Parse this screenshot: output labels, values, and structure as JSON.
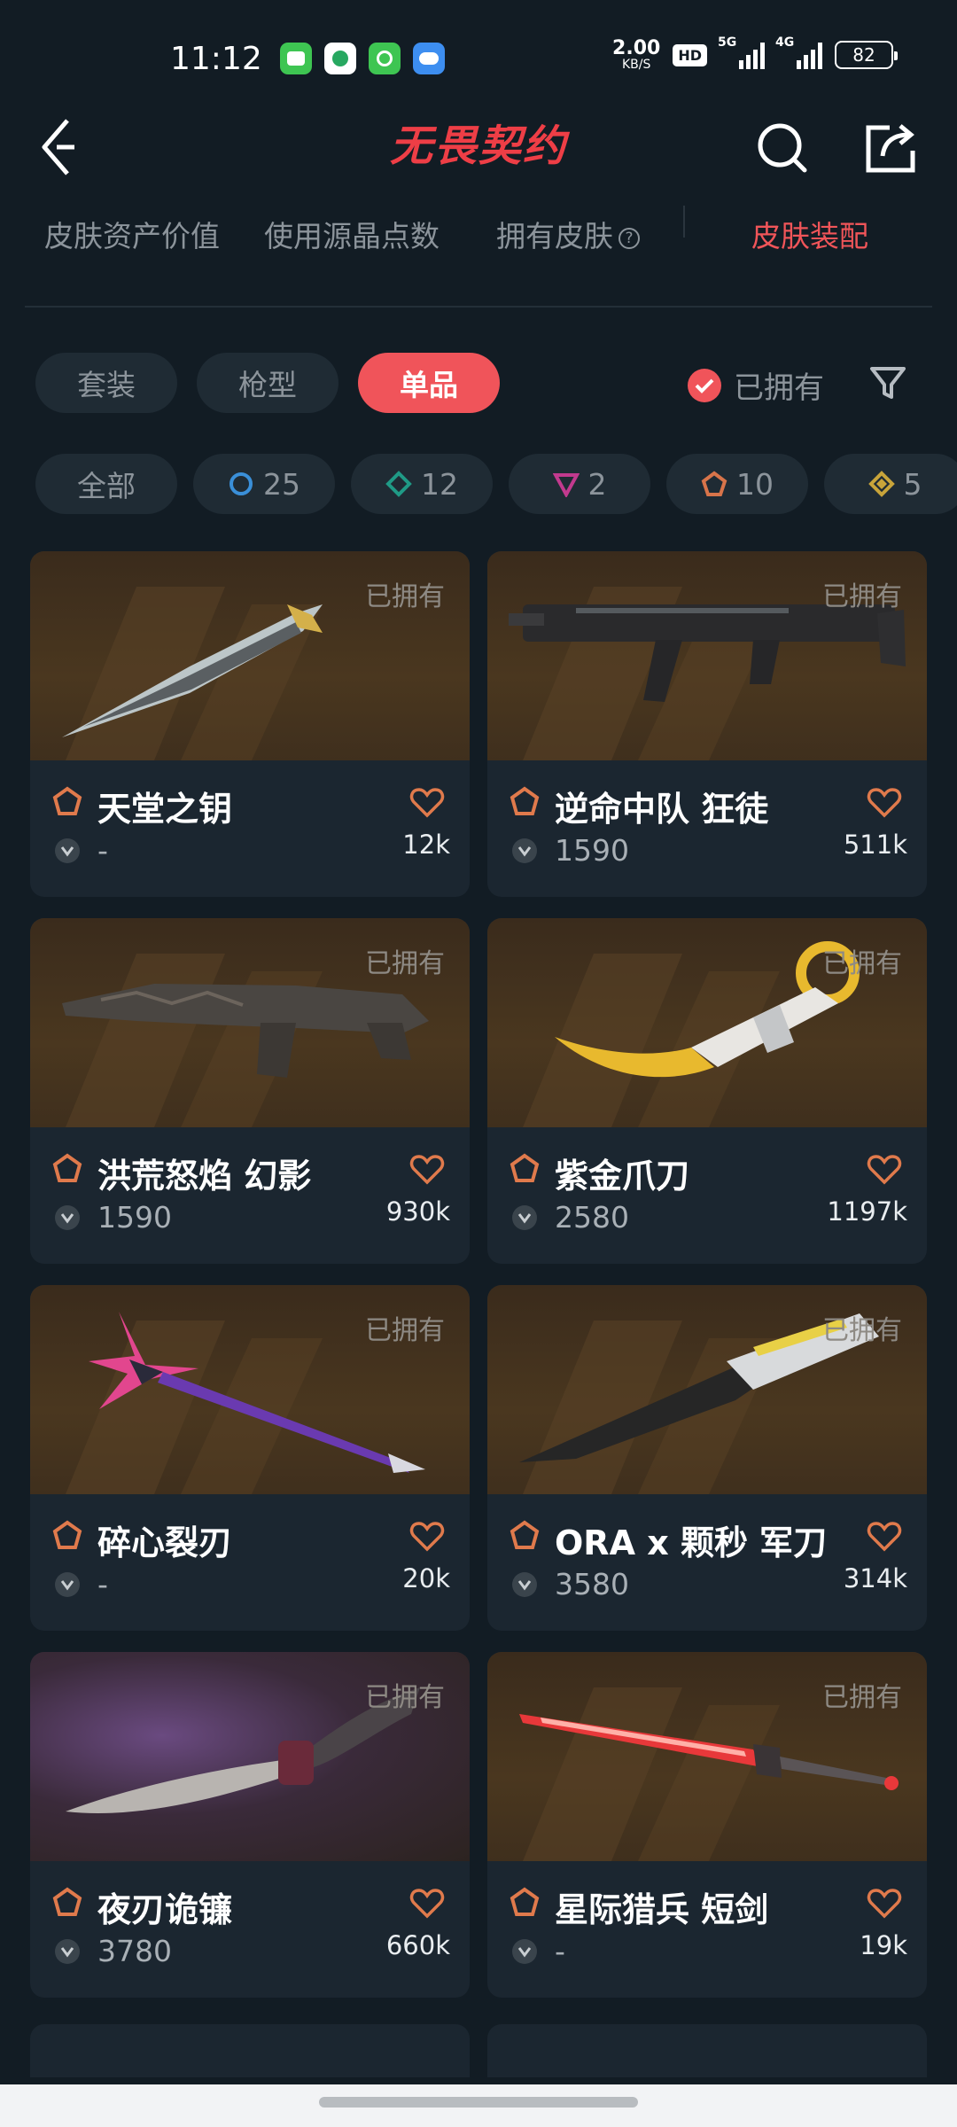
{
  "status_bar": {
    "time": "11:12",
    "net_speed": "2.00",
    "net_unit": "KB/S",
    "hd": "HD",
    "net1": "5G",
    "net2": "4G",
    "battery": "82"
  },
  "header": {
    "title": "无畏契约"
  },
  "top_tabs": [
    {
      "label": "皮肤资产价值"
    },
    {
      "label": "使用源晶点数"
    },
    {
      "label": "拥有皮肤"
    },
    {
      "label": "皮肤装配"
    }
  ],
  "owned_help": "?",
  "type_filters": [
    {
      "label": "套装"
    },
    {
      "label": "枪型"
    },
    {
      "label": "单品"
    }
  ],
  "owned_toggle": {
    "label": "已拥有",
    "checked": true
  },
  "rarity_filters": [
    {
      "label": "全部",
      "count": ""
    },
    {
      "label": "",
      "count": "25",
      "color": "#3a8fd8"
    },
    {
      "label": "",
      "count": "12",
      "color": "#1f9a86"
    },
    {
      "label": "",
      "count": "2",
      "color": "#c23a8e"
    },
    {
      "label": "",
      "count": "10",
      "color": "#d8744a"
    },
    {
      "label": "",
      "count": "5",
      "color": "#c8a43a"
    }
  ],
  "items": [
    {
      "name": "天堂之钥",
      "price": "-",
      "favorites": "12k",
      "owned": "已拥有"
    },
    {
      "name": "逆命中队 狂徒",
      "price": "1590",
      "favorites": "511k",
      "owned": "已拥有"
    },
    {
      "name": "洪荒怒焰 幻影",
      "price": "1590",
      "favorites": "930k",
      "owned": "已拥有"
    },
    {
      "name": "紫金爪刀",
      "price": "2580",
      "favorites": "1197k",
      "owned": "已拥有"
    },
    {
      "name": "碎心裂刃",
      "price": "-",
      "favorites": "20k",
      "owned": "已拥有"
    },
    {
      "name": "ORA x 颗秒 军刀",
      "price": "3580",
      "favorites": "314k",
      "owned": "已拥有"
    },
    {
      "name": "夜刃诡镰",
      "price": "3780",
      "favorites": "660k",
      "owned": "已拥有"
    },
    {
      "name": "星际猎兵 短剑",
      "price": "-",
      "favorites": "19k",
      "owned": "已拥有"
    }
  ],
  "colors": {
    "accent": "#f0545a",
    "background": "#121c24",
    "card": "#1b2630",
    "tier_orange": "#e07a4c"
  }
}
